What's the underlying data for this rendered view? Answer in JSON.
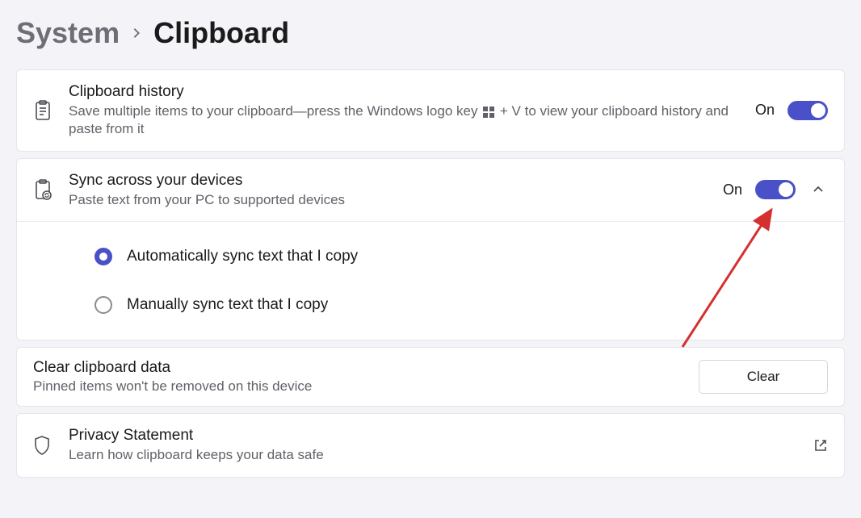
{
  "breadcrumb": {
    "root": "System",
    "leaf": "Clipboard"
  },
  "history": {
    "title": "Clipboard history",
    "desc_before": "Save multiple items to your clipboard—press the Windows logo key ",
    "desc_after": " + V to view your clipboard history and paste from it",
    "toggle_label": "On",
    "toggle_on": true
  },
  "sync": {
    "title": "Sync across your devices",
    "desc": "Paste text from your PC to supported devices",
    "toggle_label": "On",
    "toggle_on": true,
    "expanded": true,
    "options": {
      "auto": "Automatically sync text that I copy",
      "manual": "Manually sync text that I copy",
      "selected": "auto"
    }
  },
  "clear": {
    "title": "Clear clipboard data",
    "desc": "Pinned items won't be removed on this device",
    "button": "Clear"
  },
  "privacy": {
    "title": "Privacy Statement",
    "desc": "Learn how clipboard keeps your data safe"
  },
  "annotation": {
    "type": "arrow",
    "color": "#d53030",
    "target": "sync-toggle"
  }
}
